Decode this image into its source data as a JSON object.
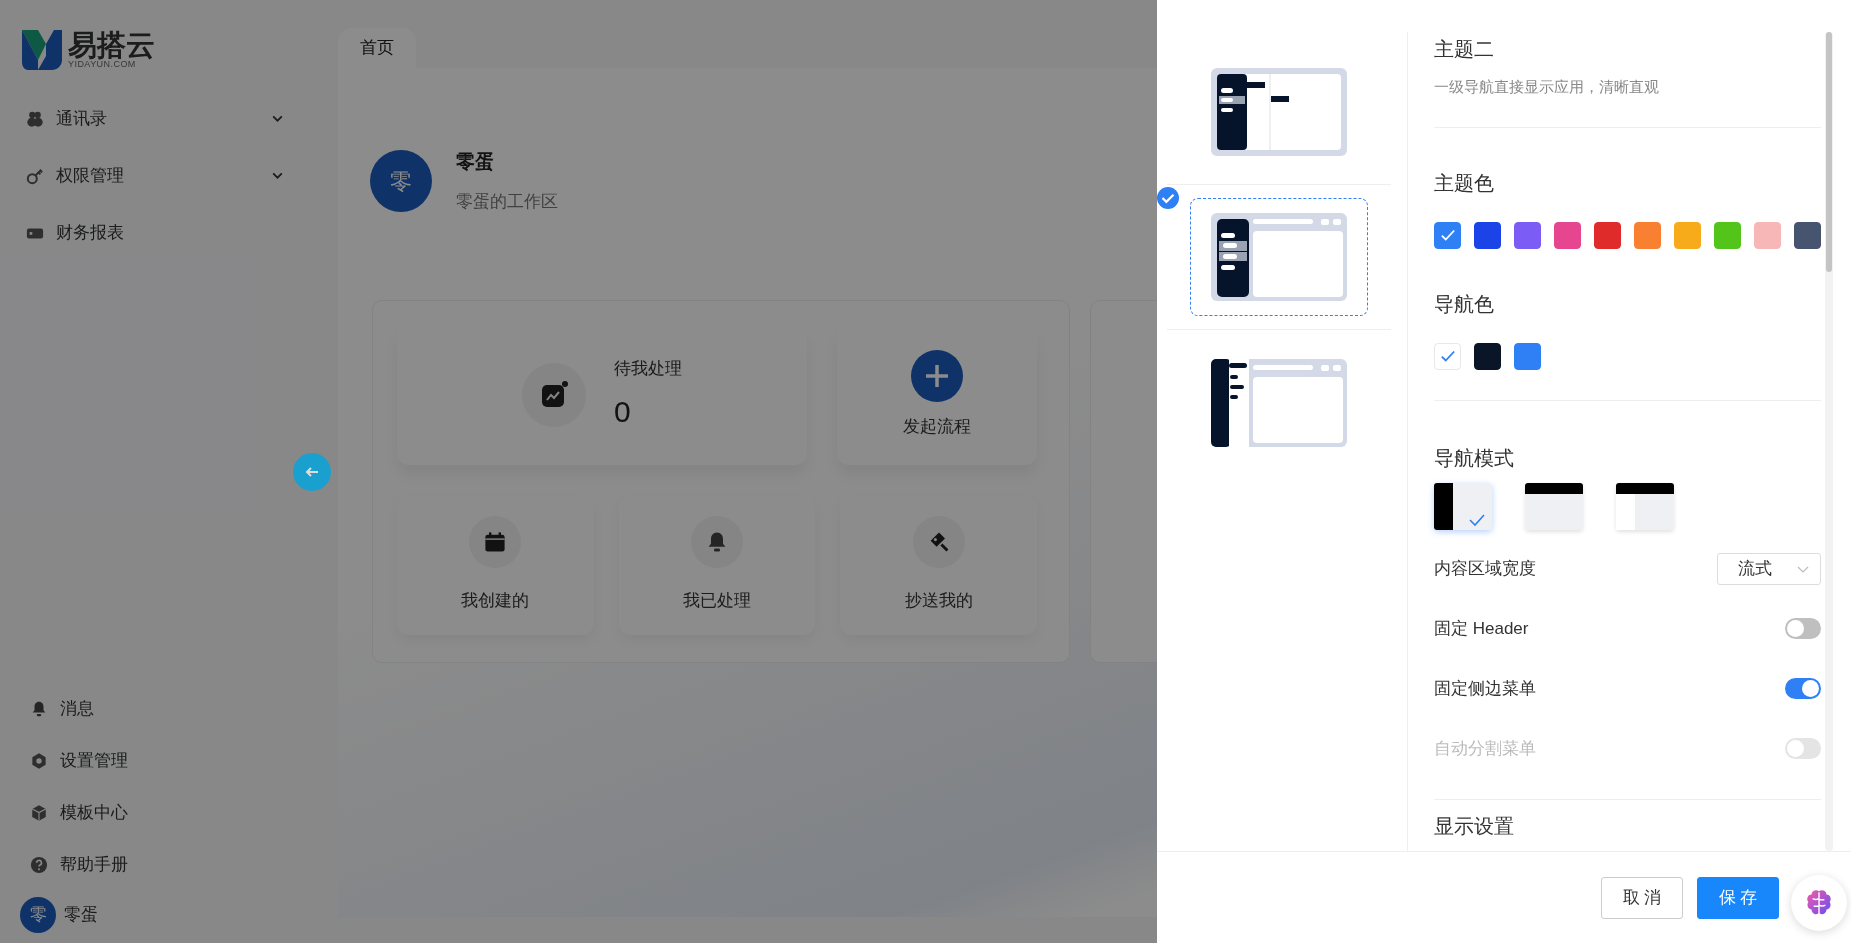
{
  "sidebar": {
    "logo": {
      "name": "易搭云",
      "subtitle": "YIDAYUN.COM"
    },
    "menu": [
      {
        "label": "通讯录",
        "expandable": true
      },
      {
        "label": "权限管理",
        "expandable": true
      },
      {
        "label": "财务报表",
        "expandable": false
      }
    ],
    "bottom": [
      {
        "label": "消息"
      },
      {
        "label": "设置管理"
      },
      {
        "label": "模板中心"
      },
      {
        "label": "帮助手册"
      }
    ],
    "user": {
      "avatar": "零",
      "name": "零蛋"
    }
  },
  "tabs": [
    {
      "label": "首页",
      "selected": true
    }
  ],
  "workspace": {
    "avatar": "零",
    "name": "零蛋",
    "subtitle": "零蛋的工作区"
  },
  "pending": {
    "label": "待我处理",
    "count": "0"
  },
  "start": {
    "label": "发起流程"
  },
  "shortcuts": [
    {
      "label": "我创建的"
    },
    {
      "label": "我已处理"
    },
    {
      "label": "抄送我的"
    }
  ],
  "drawer": {
    "themes": [
      {
        "kind": "columns",
        "selected": false
      },
      {
        "kind": "sidebar",
        "selected": true
      },
      {
        "kind": "split",
        "selected": false
      }
    ],
    "theme_title": "主题二",
    "theme_desc": "一级导航直接显示应用，清晰直观",
    "theme_color": {
      "label": "主题色",
      "swatches": [
        {
          "color": "#2f7ff5",
          "selected": true
        },
        {
          "color": "#1a44e8",
          "selected": false
        },
        {
          "color": "#7b5cf5",
          "selected": false
        },
        {
          "color": "#e5468f",
          "selected": false
        },
        {
          "color": "#e02b2b",
          "selected": false
        },
        {
          "color": "#f98031",
          "selected": false
        },
        {
          "color": "#f7ab1b",
          "selected": false
        },
        {
          "color": "#52c41a",
          "selected": false
        },
        {
          "color": "#f8b7b7",
          "selected": false
        },
        {
          "color": "#475470",
          "selected": false
        }
      ]
    },
    "nav_color": {
      "label": "导航色",
      "swatches": [
        {
          "color": "#ffffff",
          "selected": true
        },
        {
          "color": "#0a1628",
          "selected": false
        },
        {
          "color": "#2f80f5",
          "selected": false
        }
      ]
    },
    "nav_mode": {
      "label": "导航模式",
      "modes": [
        {
          "kind": "side",
          "selected": true
        },
        {
          "kind": "top",
          "selected": false
        },
        {
          "kind": "mixed",
          "selected": false
        }
      ]
    },
    "content_width": {
      "label": "内容区域宽度",
      "value": "流式"
    },
    "switches": [
      {
        "label": "固定 Header",
        "on": false,
        "disabled": false
      },
      {
        "label": "固定侧边菜单",
        "on": true,
        "disabled": false
      },
      {
        "label": "自动分割菜单",
        "on": false,
        "disabled": true
      }
    ],
    "next_section": "显示设置",
    "buttons": [
      {
        "label": "取 消",
        "kind": "default"
      },
      {
        "label": "保 存",
        "kind": "primary"
      }
    ]
  }
}
